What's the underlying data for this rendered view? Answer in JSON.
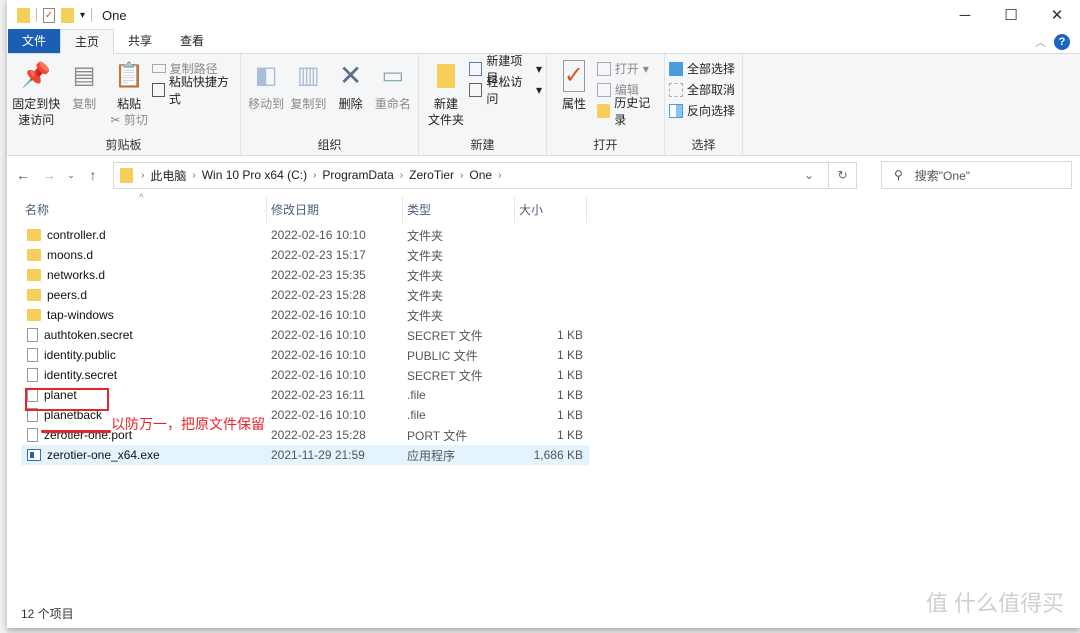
{
  "window": {
    "title": "One",
    "minimize": "─",
    "maximize": "☐",
    "close": "✕"
  },
  "tabs": [
    {
      "label": "文件"
    },
    {
      "label": "主页"
    },
    {
      "label": "共享"
    },
    {
      "label": "查看"
    }
  ],
  "help": "?",
  "ribbon": {
    "clipboard": {
      "label": "剪贴板",
      "pin": "固定到快速访问",
      "pin1": "固定到快",
      "pin2": "速访问",
      "copy": "复制",
      "paste": "粘贴",
      "copy_path": "复制路径",
      "paste_shortcut": "粘贴快捷方式",
      "cut": "剪切"
    },
    "organize": {
      "label": "组织",
      "move_to": "移动到",
      "copy_to": "复制到",
      "delete": "删除",
      "rename": "重命名"
    },
    "new": {
      "label": "新建",
      "new_folder1": "新建",
      "new_folder2": "文件夹",
      "new_item": "新建项目",
      "easy_access": "轻松访问"
    },
    "open": {
      "label": "打开",
      "properties": "属性",
      "open": "打开",
      "edit": "编辑",
      "history": "历史记录"
    },
    "select": {
      "label": "选择",
      "select_all": "全部选择",
      "select_none": "全部取消",
      "invert": "反向选择"
    }
  },
  "address": {
    "crumbs": [
      "此电脑",
      "Win 10 Pro x64 (C:)",
      "ProgramData",
      "ZeroTier",
      "One"
    ],
    "search_placeholder": "搜索\"One\""
  },
  "columns": {
    "name": "名称",
    "date": "修改日期",
    "type": "类型",
    "size": "大小"
  },
  "files": [
    {
      "name": "controller.d",
      "date": "2022-02-16 10:10",
      "type": "文件夹",
      "size": "",
      "icon": "folder"
    },
    {
      "name": "moons.d",
      "date": "2022-02-23 15:17",
      "type": "文件夹",
      "size": "",
      "icon": "folder"
    },
    {
      "name": "networks.d",
      "date": "2022-02-23 15:35",
      "type": "文件夹",
      "size": "",
      "icon": "folder"
    },
    {
      "name": "peers.d",
      "date": "2022-02-23 15:28",
      "type": "文件夹",
      "size": "",
      "icon": "folder"
    },
    {
      "name": "tap-windows",
      "date": "2022-02-16 10:10",
      "type": "文件夹",
      "size": "",
      "icon": "folder"
    },
    {
      "name": "authtoken.secret",
      "date": "2022-02-16 10:10",
      "type": "SECRET 文件",
      "size": "1 KB",
      "icon": "file"
    },
    {
      "name": "identity.public",
      "date": "2022-02-16 10:10",
      "type": "PUBLIC 文件",
      "size": "1 KB",
      "icon": "file"
    },
    {
      "name": "identity.secret",
      "date": "2022-02-16 10:10",
      "type": "SECRET 文件",
      "size": "1 KB",
      "icon": "file"
    },
    {
      "name": "planet",
      "date": "2022-02-23 16:11",
      "type": ".file",
      "size": "1 KB",
      "icon": "file"
    },
    {
      "name": "planetback",
      "date": "2022-02-16 10:10",
      "type": ".file",
      "size": "1 KB",
      "icon": "file"
    },
    {
      "name": "zerotier-one.port",
      "date": "2022-02-23 15:28",
      "type": "PORT 文件",
      "size": "1 KB",
      "icon": "file"
    },
    {
      "name": "zerotier-one_x64.exe",
      "date": "2021-11-29 21:59",
      "type": "应用程序",
      "size": "1,686 KB",
      "icon": "exe"
    }
  ],
  "annotation": "以防万一，把原文件保留",
  "status": "12 个项目",
  "watermark": "值 什么值得买",
  "colors": {
    "accent": "#1a5fb4",
    "annotation": "#e5242b",
    "selected_row": "#e5f3ff"
  }
}
